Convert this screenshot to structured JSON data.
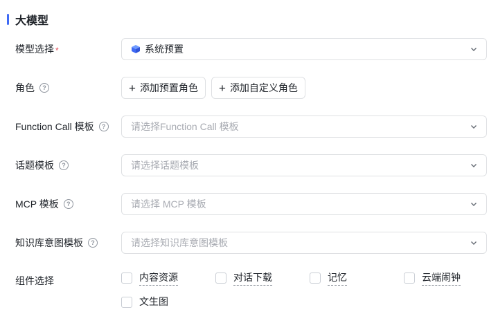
{
  "section": {
    "title": "大模型"
  },
  "form": {
    "model": {
      "label": "模型选择",
      "required_mark": "*",
      "value": "系统预置"
    },
    "role": {
      "label": "角色",
      "help": "?",
      "buttons": [
        "添加预置角色",
        "添加自定义角色"
      ]
    },
    "function_call": {
      "label": "Function Call 模板",
      "help": "?",
      "placeholder": "请选择Function Call 模板"
    },
    "topic": {
      "label": "话题模板",
      "help": "?",
      "placeholder": "请选择话题模板"
    },
    "mcp": {
      "label": "MCP 模板",
      "help": "?",
      "placeholder": "请选择 MCP 模板"
    },
    "kb_intent": {
      "label": "知识库意图模板",
      "help": "?",
      "placeholder": "请选择知识库意图模板"
    },
    "components": {
      "label": "组件选择",
      "options": [
        "内容资源",
        "对话下载",
        "记忆",
        "云端闹钟",
        "文生图"
      ]
    }
  },
  "icons": {
    "model_value_icon": "cube-icon",
    "dropdown": "chevron-down-icon",
    "add": "plus-icon",
    "help": "question-circle-icon"
  },
  "colors": {
    "accent": "#3f6af5",
    "required": "#e34d59",
    "placeholder": "#a8abb2",
    "border": "#dee0e3"
  }
}
